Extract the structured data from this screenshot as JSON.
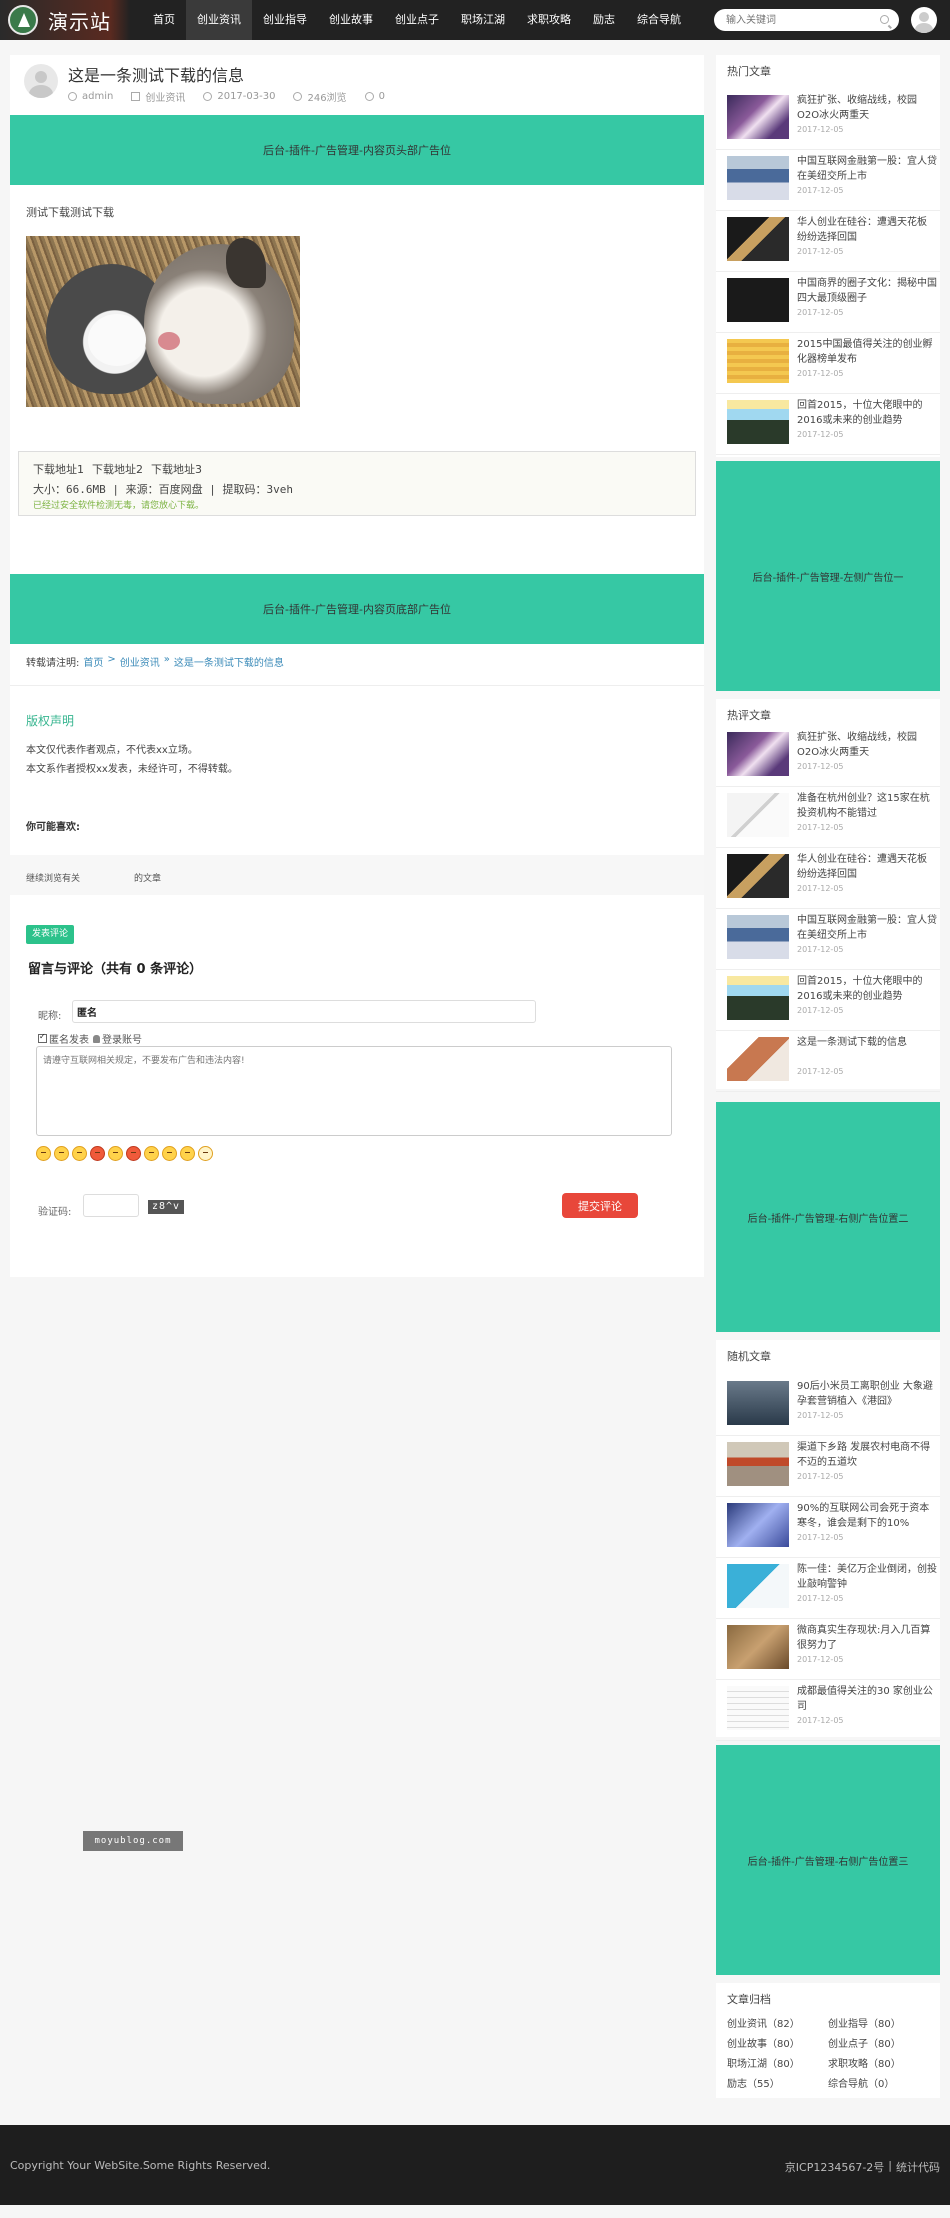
{
  "nav": {
    "logo_text": "演示站",
    "menu": [
      "首页",
      "创业资讯",
      "创业指导",
      "创业故事",
      "创业点子",
      "职场江湖",
      "求职攻略",
      "励志",
      "综合导航"
    ],
    "active_index": 1,
    "search_placeholder": "输入关键词"
  },
  "post": {
    "title": "这是一条测试下载的信息",
    "author": "admin",
    "category": "创业资讯",
    "date": "2017-03-30",
    "views": "246浏览",
    "comments": "0",
    "ad_top": "后台-插件-广告管理-内容页头部广告位",
    "content_text": "测试下载测试下载",
    "download": {
      "links": [
        "下载地址1",
        "下载地址2",
        "下载地址3"
      ],
      "info": "大小：66.6MB | 来源：百度网盘 | 提取码：3veh",
      "safe_note": "已经过安全软件检测无毒，请您放心下载。"
    },
    "ad_bottom": "后台-插件-广告管理-内容页底部广告位",
    "reprint": {
      "label": "转载请注明:",
      "home": "首页",
      "sep": ">",
      "category": "创业资讯",
      "sep2": "»",
      "title": "这是一条测试下载的信息"
    },
    "copyright": {
      "title": "版权声明",
      "line1": "本文仅代表作者观点，不代表xx立场。",
      "line2": "本文系作者授权xx发表，未经许可，不得转载。"
    },
    "may_like": "你可能喜欢:",
    "related": {
      "left": "继续浏览有关",
      "right": "的文章"
    }
  },
  "comment": {
    "badge": "发表评论",
    "title": "留言与评论（共有 0 条评论）",
    "nick_label": "昵称:",
    "nick_value": "匿名",
    "anon_label": "匿名发表",
    "login_label": "登录账号",
    "placeholder": "请遵守互联网相关规定，不要发布广告和违法内容!",
    "captcha_label": "验证码:",
    "captcha_code": "z8^v",
    "submit_label": "提交评论"
  },
  "watermark": "moyublog.com",
  "sidebar": {
    "hot": {
      "title": "热门文章",
      "items": [
        {
          "title": "疯狂扩张、收缩战线，校园O2O冰火两重天",
          "date": "2017-12-05",
          "thumb": "t-stage"
        },
        {
          "title": "中国互联网金融第一股：宜人贷在美纽交所上市",
          "date": "2017-12-05",
          "thumb": "t-stock"
        },
        {
          "title": "华人创业在硅谷：遭遇天花板 纷纷选择回国",
          "date": "2017-12-05",
          "thumb": "t-laptop"
        },
        {
          "title": "中国商界的圈子文化：揭秘中国四大最顶级圈子",
          "date": "2017-12-05",
          "thumb": "t-sign"
        },
        {
          "title": "2015中国最值得关注的创业孵化器榜单发布",
          "date": "2017-12-05",
          "thumb": "t-table"
        },
        {
          "title": "回首2015，十位大佬眼中的2016或未来的创业趋势",
          "date": "2017-12-05",
          "thumb": "t-road"
        }
      ]
    },
    "ad1": "后台-插件-广告管理-左侧广告位一",
    "comments": {
      "title": "热评文章",
      "items": [
        {
          "title": "疯狂扩张、收缩战线，校园O2O冰火两重天",
          "date": "2017-12-05",
          "thumb": "t-stage"
        },
        {
          "title": "准备在杭州创业？这15家在杭投资机构不能错过",
          "date": "2017-12-05",
          "thumb": "t-startup"
        },
        {
          "title": "华人创业在硅谷：遭遇天花板 纷纷选择回国",
          "date": "2017-12-05",
          "thumb": "t-laptop"
        },
        {
          "title": "中国互联网金融第一股：宜人贷在美纽交所上市",
          "date": "2017-12-05",
          "thumb": "t-stock"
        },
        {
          "title": "回首2015，十位大佬眼中的2016或未来的创业趋势",
          "date": "2017-12-05",
          "thumb": "t-road"
        },
        {
          "title": "这是一条测试下载的信息",
          "date": "2017-12-05",
          "thumb": "t-meeting"
        }
      ]
    },
    "ad2": "后台-插件-广告管理-右侧广告位置二",
    "random": {
      "title": "随机文章",
      "items": [
        {
          "title": "90后小米员工离职创业 大象避孕套营销植入《港囧》",
          "date": "2017-12-05",
          "thumb": "t-crowd"
        },
        {
          "title": "渠道下乡路 发展农村电商不得不迈的五道坎",
          "date": "2017-12-05",
          "thumb": "t-village"
        },
        {
          "title": "90%的互联网公司会死于资本寒冬，谁会是剩下的10%",
          "date": "2017-12-05",
          "thumb": "t-fairy"
        },
        {
          "title": "陈一佳：美亿万企业倒闭，创投业敲响警钟",
          "date": "2017-12-05",
          "thumb": "t-phone"
        },
        {
          "title": "微商真实生存现状:月入几百算很努力了",
          "date": "2017-12-05",
          "thumb": "t-coins"
        },
        {
          "title": "成都最值得关注的30 家创业公司",
          "date": "2017-12-05",
          "thumb": "t-sheet"
        }
      ]
    },
    "ad3": "后台-插件-广告管理-右侧广告位置三",
    "archive": {
      "title": "文章归档",
      "items": [
        "创业资讯（82）",
        "创业指导（80）",
        "创业故事（80）",
        "创业点子（80）",
        "职场江湖（80）",
        "求职攻略（80）",
        "励志（55）",
        "综合导航（0）"
      ]
    }
  },
  "footer": {
    "copyright": "Copyright Your WebSite.Some Rights Reserved.",
    "icp": "京ICP1234567-2号",
    "sep": "|",
    "stats": "统计代码"
  }
}
